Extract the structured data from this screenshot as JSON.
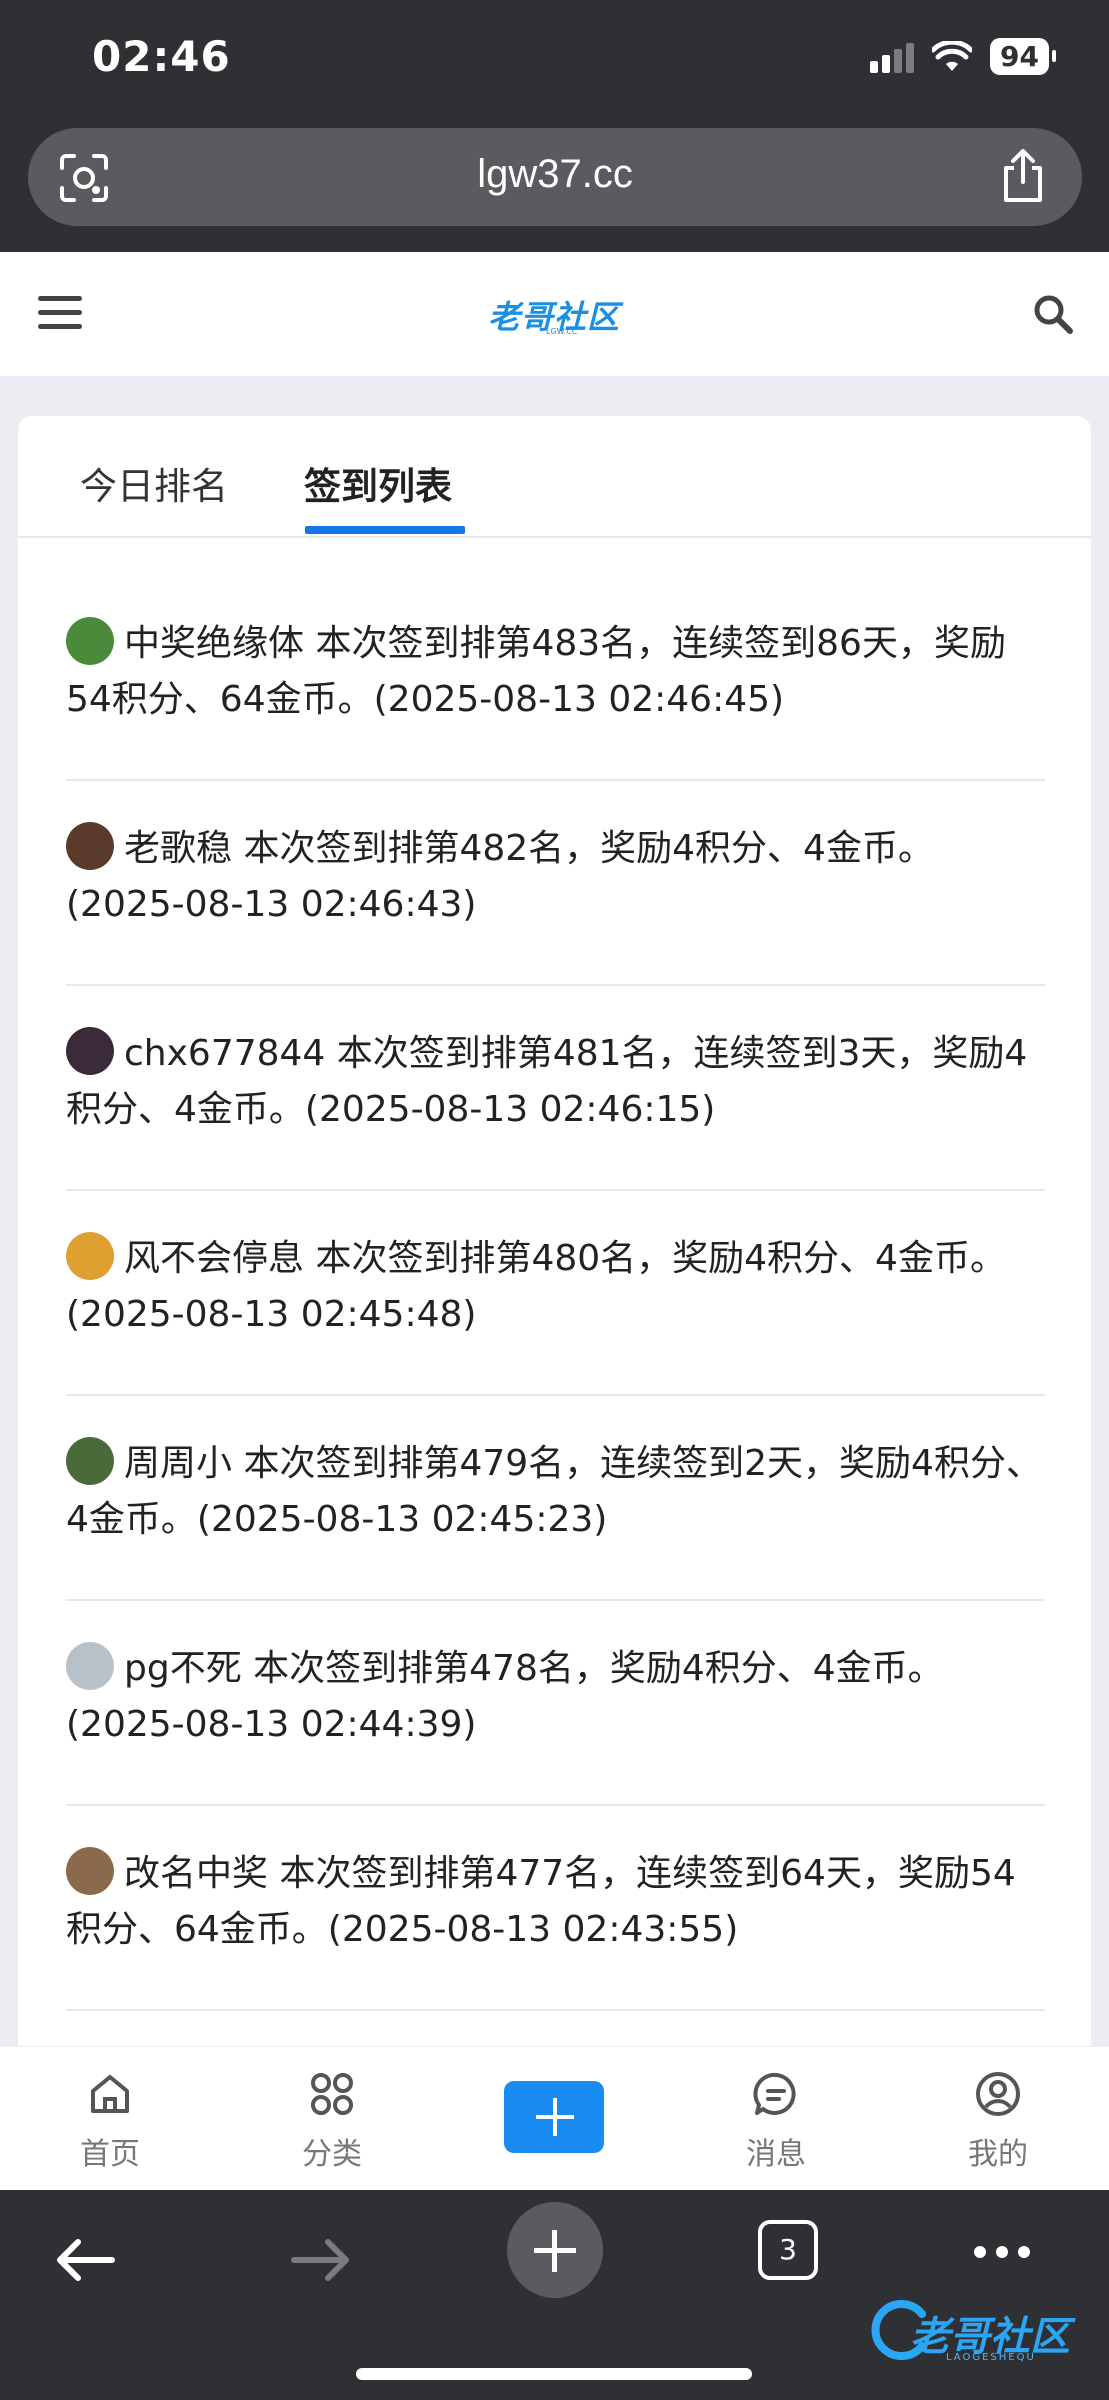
{
  "status_bar": {
    "time": "02:46",
    "battery": "94"
  },
  "browser": {
    "url": "lgw37.cc",
    "tab_count": "3"
  },
  "site": {
    "logo_text": "老哥社区",
    "logo_sub": "LGW.CC"
  },
  "tabs": [
    {
      "label": "今日排名",
      "active": false
    },
    {
      "label": "签到列表",
      "active": true
    }
  ],
  "checkins": [
    {
      "text": "中奖绝缘体 本次签到排第483名，连续签到86天，奖励54积分、64金币。(2025-08-13 02:46:45)",
      "avatar_color": "#4a8a3a"
    },
    {
      "text": "老歌稳 本次签到排第482名，奖励4积分、4金币。(2025-08-13 02:46:43)",
      "avatar_color": "#5a3a2a"
    },
    {
      "text": "chx677844 本次签到排第481名，连续签到3天，奖励4积分、4金币。(2025-08-13 02:46:15)",
      "avatar_color": "#3a2a3a"
    },
    {
      "text": "风不会停息 本次签到排第480名，奖励4积分、4金币。(2025-08-13 02:45:48)",
      "avatar_color": "#e0a030"
    },
    {
      "text": "周周小 本次签到排第479名，连续签到2天，奖励4积分、4金币。(2025-08-13 02:45:23)",
      "avatar_color": "#4a6a3a"
    },
    {
      "text": "pg不死 本次签到排第478名，奖励4积分、4金币。(2025-08-13 02:44:39)",
      "avatar_color": "#b8c0c8"
    },
    {
      "text": "改名中奖 本次签到排第477名，连续签到64天，奖励54积分、64金币。(2025-08-13 02:43:55)",
      "avatar_color": "#8a6a4a"
    }
  ],
  "bottom_nav": {
    "home": "首页",
    "category": "分类",
    "messages": "消息",
    "mine": "我的"
  },
  "watermark": {
    "text": "老哥社区",
    "sub": "LAOGESHEQU"
  },
  "colors": {
    "accent": "#1678e6",
    "plus_button": "#1a8bf0",
    "logo": "#1a8fe3"
  }
}
